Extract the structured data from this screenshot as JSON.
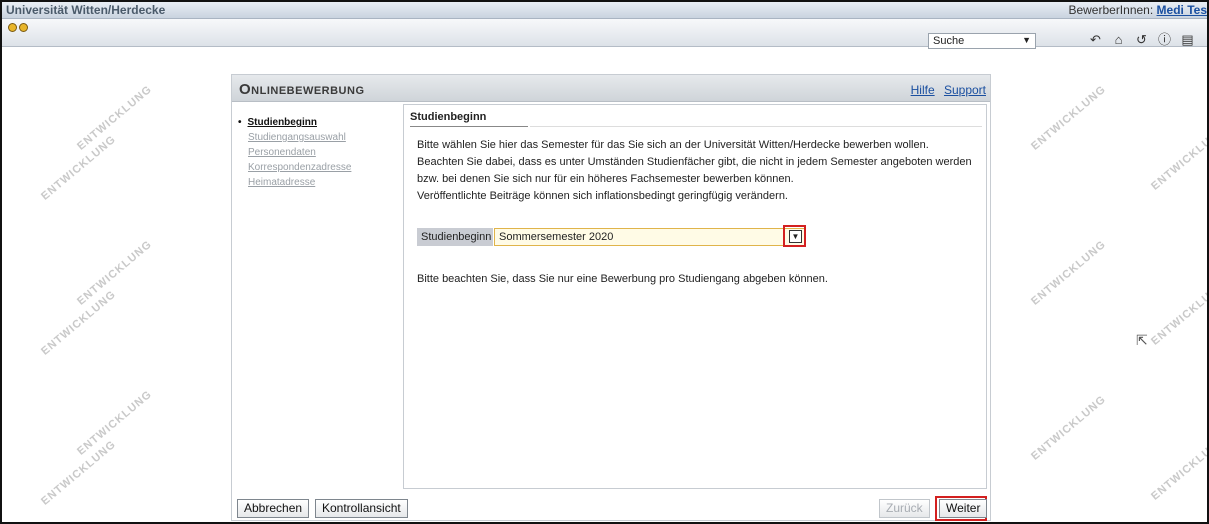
{
  "topbar": {
    "university": "Universität Witten/Herdecke",
    "applicant_label": "BewerberInnen:",
    "applicant_name": "Medi Tes"
  },
  "toolbar": {
    "search_select": "Suche",
    "icons": [
      "back-icon",
      "home-icon",
      "refresh-icon",
      "info-icon",
      "language-icon"
    ]
  },
  "watermark_text": "ENTWICKLUNG",
  "panel": {
    "title": "Onlinebewerbung",
    "help_link": "Hilfe",
    "support_link": "Support"
  },
  "nav": {
    "items": [
      {
        "label": "Studienbeginn",
        "active": true
      },
      {
        "label": "Studiengangsauswahl",
        "active": false
      },
      {
        "label": "Personendaten",
        "active": false
      },
      {
        "label": "Korrespondenzadresse",
        "active": false
      },
      {
        "label": "Heimatadresse",
        "active": false
      }
    ]
  },
  "content": {
    "section_title": "Studienbeginn",
    "paragraph": [
      "Bitte wählen Sie hier das Semester für das Sie sich an der Universität Witten/Herdecke bewerben wollen.",
      "Beachten Sie dabei, dass es unter Umständen Studienfächer gibt, die nicht in jedem Semester angeboten werden",
      "bzw. bei denen Sie sich nur für ein höheres Fachsemester bewerben können.",
      "Veröffentlichte Beiträge können sich inflationsbedingt geringfügig verändern."
    ],
    "field_label": "Studienbeginn",
    "field_value": "Sommersemester 2020",
    "note": "Bitte beachten Sie, dass Sie nur eine Bewerbung pro Studiengang abgeben können."
  },
  "buttons": {
    "cancel": "Abbrechen",
    "control_view": "Kontrollansicht",
    "back": "Zurück",
    "next": "Weiter"
  },
  "colors": {
    "highlight": "#d32020",
    "link": "#1a4fa0"
  }
}
